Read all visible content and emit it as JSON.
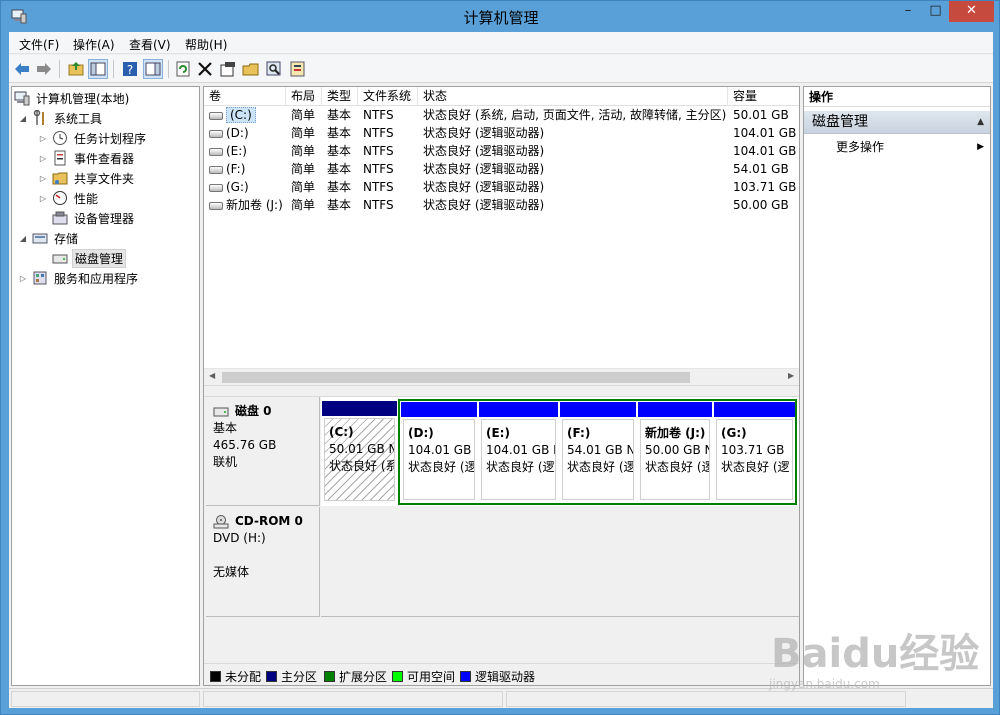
{
  "window": {
    "title": "计算机管理",
    "min": "–",
    "max": "□",
    "close": "✕"
  },
  "menu": [
    "文件(F)",
    "操作(A)",
    "查看(V)",
    "帮助(H)"
  ],
  "toolbar": {
    "icons": [
      "back-arrow-icon",
      "forward-arrow-icon",
      "up-folder-icon",
      "show-tree-icon",
      "help-icon",
      "properties-view-icon",
      "refresh-icon",
      "delete-icon",
      "properties-icon",
      "open-icon",
      "search-icon",
      "wizard-icon"
    ]
  },
  "tree": {
    "root": "计算机管理(本地)",
    "system_tools": "系统工具",
    "task_scheduler": "任务计划程序",
    "event_viewer": "事件查看器",
    "shared_folders": "共享文件夹",
    "performance": "性能",
    "device_manager": "设备管理器",
    "storage": "存储",
    "disk_management": "磁盘管理",
    "services_apps": "服务和应用程序"
  },
  "volumes": {
    "headers": [
      "卷",
      "布局",
      "类型",
      "文件系统",
      "状态",
      "容量"
    ],
    "rows": [
      [
        "(C:)",
        "简单",
        "基本",
        "NTFS",
        "状态良好 (系统, 启动, 页面文件, 活动, 故障转储, 主分区)",
        "50.01 GB"
      ],
      [
        "(D:)",
        "简单",
        "基本",
        "NTFS",
        "状态良好 (逻辑驱动器)",
        "104.01 GB"
      ],
      [
        "(E:)",
        "简单",
        "基本",
        "NTFS",
        "状态良好 (逻辑驱动器)",
        "104.01 GB"
      ],
      [
        "(F:)",
        "简单",
        "基本",
        "NTFS",
        "状态良好 (逻辑驱动器)",
        "54.01 GB"
      ],
      [
        "(G:)",
        "简单",
        "基本",
        "NTFS",
        "状态良好 (逻辑驱动器)",
        "103.71 GB"
      ],
      [
        "新加卷 (J:)",
        "简单",
        "基本",
        "NTFS",
        "状态良好 (逻辑驱动器)",
        "50.00 GB"
      ]
    ]
  },
  "disk0": {
    "name": "磁盘 0",
    "type": "基本",
    "size": "465.76 GB",
    "state": "联机",
    "partitions": [
      {
        "name": "(C:)",
        "size": "50.01 GB N",
        "status": "状态良好 (系"
      },
      {
        "name": "(D:)",
        "size": "104.01 GB",
        "status": "状态良好 (逻"
      },
      {
        "name": "(E:)",
        "size": "104.01 GB I",
        "status": "状态良好 (逻"
      },
      {
        "name": "(F:)",
        "size": "54.01 GB N",
        "status": "状态良好 (逻"
      },
      {
        "name": "新加卷  (J:)",
        "size": "50.00 GB N",
        "status": "状态良好 (逻"
      },
      {
        "name": "(G:)",
        "size": "103.71 GB",
        "status": "状态良好 (逻"
      }
    ]
  },
  "cdrom": {
    "name": "CD-ROM 0",
    "drive": "DVD (H:)",
    "media": "无媒体"
  },
  "legend": [
    {
      "label": "未分配",
      "color": "#000000"
    },
    {
      "label": "主分区",
      "color": "#000080"
    },
    {
      "label": "扩展分区",
      "color": "#008000"
    },
    {
      "label": "可用空间",
      "color": "#00ff00"
    },
    {
      "label": "逻辑驱动器",
      "color": "#0000ff"
    }
  ],
  "actions": {
    "header": "操作",
    "section": "磁盘管理",
    "more": "更多操作"
  },
  "watermark": {
    "brand": "Baidu经验",
    "url": "jingyan.baidu.com"
  },
  "colors": {
    "primary": "#000080",
    "extended": "#008000",
    "logical": "#0000ff",
    "titlebar": "#5aa0d8"
  }
}
